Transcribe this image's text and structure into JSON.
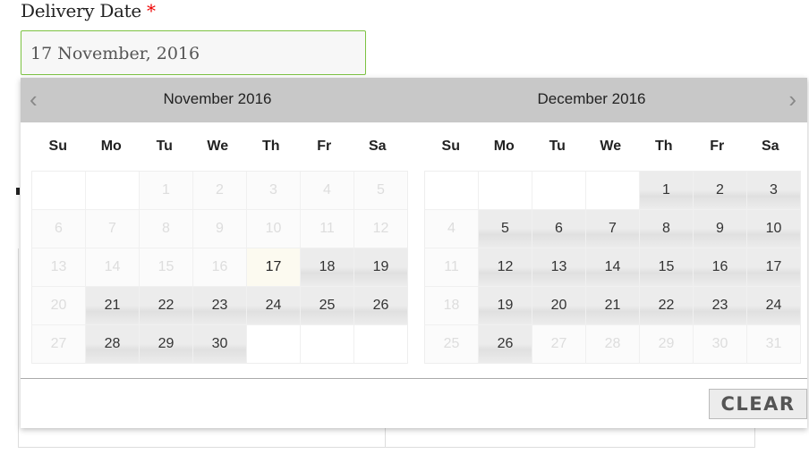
{
  "field": {
    "label": "Delivery Date",
    "required_mark": "*",
    "value": "17 November, 2016"
  },
  "calendar": {
    "prev_icon": "‹",
    "next_icon": "›",
    "weekdays": [
      "Su",
      "Mo",
      "Tu",
      "We",
      "Th",
      "Fr",
      "Sa"
    ],
    "months": [
      {
        "title": "November 2016",
        "lead_blanks": 2,
        "days": 30,
        "today": 17,
        "available": [
          18,
          19,
          21,
          22,
          23,
          24,
          25,
          26,
          28,
          29,
          30
        ]
      },
      {
        "title": "December 2016",
        "lead_blanks": 4,
        "days": 31,
        "today": null,
        "available": [
          1,
          2,
          3,
          5,
          6,
          7,
          8,
          9,
          10,
          12,
          13,
          14,
          15,
          16,
          17,
          19,
          20,
          21,
          22,
          23,
          24,
          26
        ]
      }
    ],
    "clear_label": "CLEAR"
  }
}
